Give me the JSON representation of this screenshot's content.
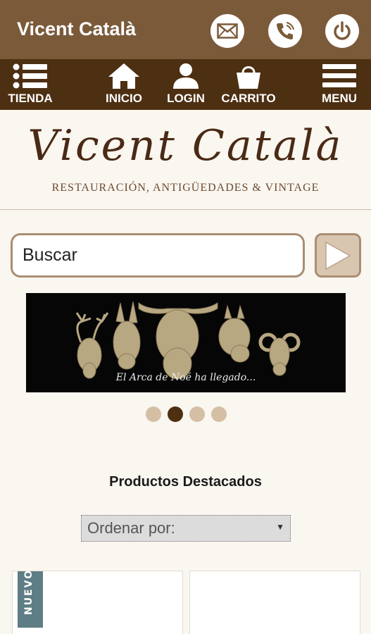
{
  "header": {
    "title": "Vicent Català",
    "actions": [
      {
        "name": "mail-icon"
      },
      {
        "name": "phone-icon"
      },
      {
        "name": "power-icon"
      }
    ]
  },
  "nav": {
    "items": [
      {
        "label": "TIENDA",
        "icon": "list-icon"
      },
      {
        "label": "INICIO",
        "icon": "home-icon"
      },
      {
        "label": "LOGIN",
        "icon": "user-icon"
      },
      {
        "label": "CARRITO",
        "icon": "basket-icon"
      },
      {
        "label": "MENU",
        "icon": "hamburger-icon"
      }
    ]
  },
  "brand": {
    "logo_text": "Vicent Català",
    "tagline": "RESTAURACIÓN, ANTIGÜEDADES & VINTAGE"
  },
  "search": {
    "placeholder": "Buscar",
    "button_icon": "play-arrow-icon"
  },
  "banner": {
    "caption": "El Arca de Noé ha llegado...",
    "slide_count": 4,
    "active_slide": 2
  },
  "products": {
    "section_title": "Productos Destacados",
    "sort_label": "Ordenar por:",
    "badge": "NUEVO"
  },
  "colors": {
    "topbar": "#7b5a3a",
    "navbar": "#4d2f12",
    "background": "#faf6f0",
    "accent": "#a98e72",
    "badge": "#5e7d84"
  }
}
